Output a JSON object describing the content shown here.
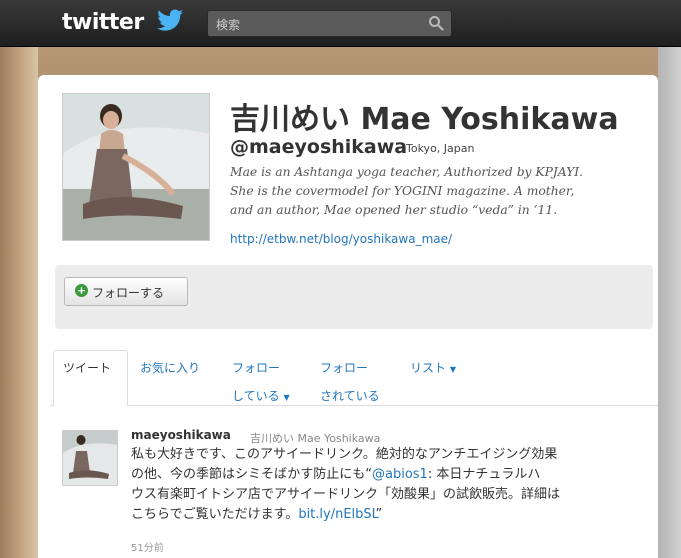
{
  "header": {
    "logo": "twitter",
    "search_placeholder": "検索"
  },
  "profile": {
    "name": "吉川めい Mae Yoshikawa",
    "handle": "@maeyoshikawa",
    "location": "Tokyo, Japan",
    "bio_lines": [
      "Mae is an Ashtanga yoga teacher, Authorized by KPJAYI.",
      "She is the covermodel for YOGINI magazine. A mother,",
      "and an author, Mae opened her studio “veda” in ’11."
    ],
    "url": "http://etbw.net/blog/yoshikawa_mae/"
  },
  "actions": {
    "follow_label": "フォローする"
  },
  "tabs": [
    {
      "label": "ツイート"
    },
    {
      "label": "お気に入り"
    },
    {
      "label": "フォロー",
      "label2": "している"
    },
    {
      "label": "フォロー",
      "label2": "されている"
    },
    {
      "label": "リスト"
    }
  ],
  "tweet": {
    "username": "maeyoshikawa",
    "realname": "吉川めい Mae Yoshikawa",
    "line1": "私も大好きです、このアサイードリンク。絶対的なアンチエイジング効果",
    "line2_pre": "の他、今の季節はシミそばかす防止にも“",
    "line2_mention": "@abios1",
    "line2_post": ": 本日ナチュラルハ",
    "line3": "ウス有楽町イトシア店でアサイードリンク「効酸果」の試飲販売。詳細は",
    "line4_pre": "こちらでご覧いただけます。",
    "line4_link": "bit.ly/nElbSL",
    "line4_post": "”",
    "time": "51分前"
  },
  "colors": {
    "link": "#2276bb",
    "topbar": "#1e1e1e",
    "follow_plus": "#3a9a3a"
  }
}
